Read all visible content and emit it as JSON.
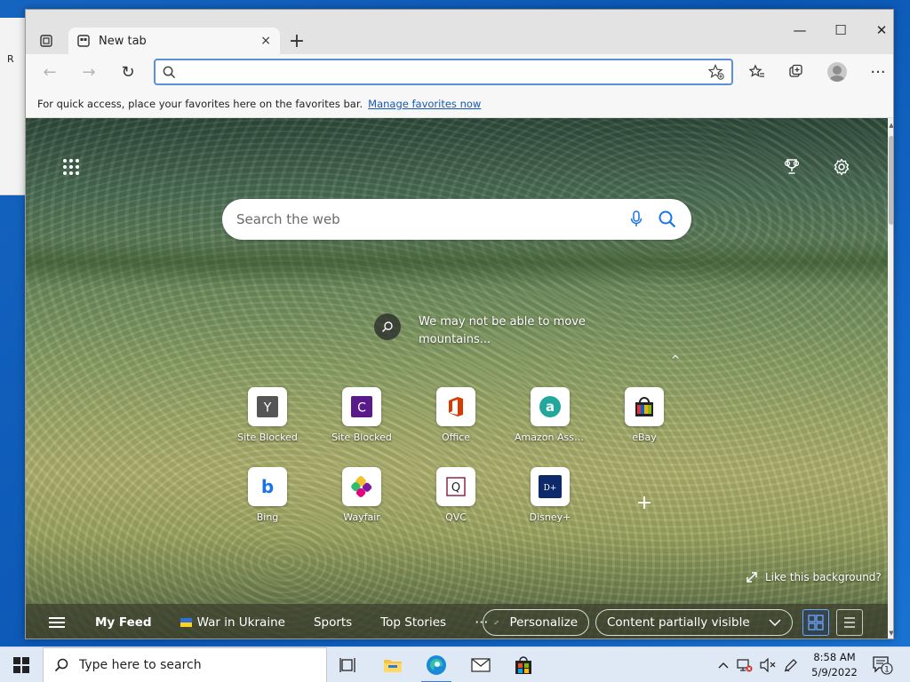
{
  "desktop": {
    "fragment_text": "R"
  },
  "browser": {
    "tab": {
      "title": "New tab",
      "close_glyph": "×"
    },
    "new_tab_glyph": "+",
    "window_controls": {
      "minimize": "—",
      "maximize": "☐",
      "close": "✕"
    },
    "toolbar": {
      "back": "←",
      "forward": "→",
      "refresh": "↻",
      "more": "···",
      "address_value": "",
      "address_placeholder": ""
    },
    "favorites_bar": {
      "message": "For quick access, place your favorites here on the favorites bar.",
      "link": "Manage favorites now"
    }
  },
  "newtab": {
    "search_placeholder": "Search the web",
    "image_caption": "We may not be able to move mountains...",
    "collapse_glyph": "^",
    "quick_links": [
      {
        "label": "Site Blocked",
        "icon": "letter-y-icon",
        "glyph": "Y",
        "color": "#555555"
      },
      {
        "label": "Site Blocked",
        "icon": "letter-c-icon",
        "glyph": "C",
        "color": "#5b1a8a"
      },
      {
        "label": "Office",
        "icon": "office-icon",
        "glyph": "",
        "color": "#d83b01"
      },
      {
        "label": "Amazon Assi...",
        "icon": "amazon-icon",
        "glyph": "a",
        "color": "#22a89a"
      },
      {
        "label": "eBay",
        "icon": "ebay-bag-icon",
        "glyph": "",
        "color": "#e53238"
      },
      {
        "label": "Bing",
        "icon": "bing-icon",
        "glyph": "b",
        "color": "#1a73e8"
      },
      {
        "label": "Wayfair",
        "icon": "wayfair-icon",
        "glyph": "",
        "color": "#7b189f"
      },
      {
        "label": "QVC",
        "icon": "qvc-icon",
        "glyph": "Q",
        "color": "#8b1538"
      },
      {
        "label": "Disney+",
        "icon": "disney-plus-icon",
        "glyph": "D+",
        "color": "#0f2a6b"
      }
    ],
    "add_glyph": "+",
    "like_background": "Like this background?",
    "feed": {
      "items": [
        "My Feed",
        "War in Ukraine",
        "Sports",
        "Top Stories"
      ],
      "more": "···",
      "personalize": "Personalize",
      "content_visibility": "Content partially visible"
    }
  },
  "taskbar": {
    "search_placeholder": "Type here to search",
    "time": "8:58 AM",
    "date": "5/9/2022",
    "notification_count": "1"
  }
}
